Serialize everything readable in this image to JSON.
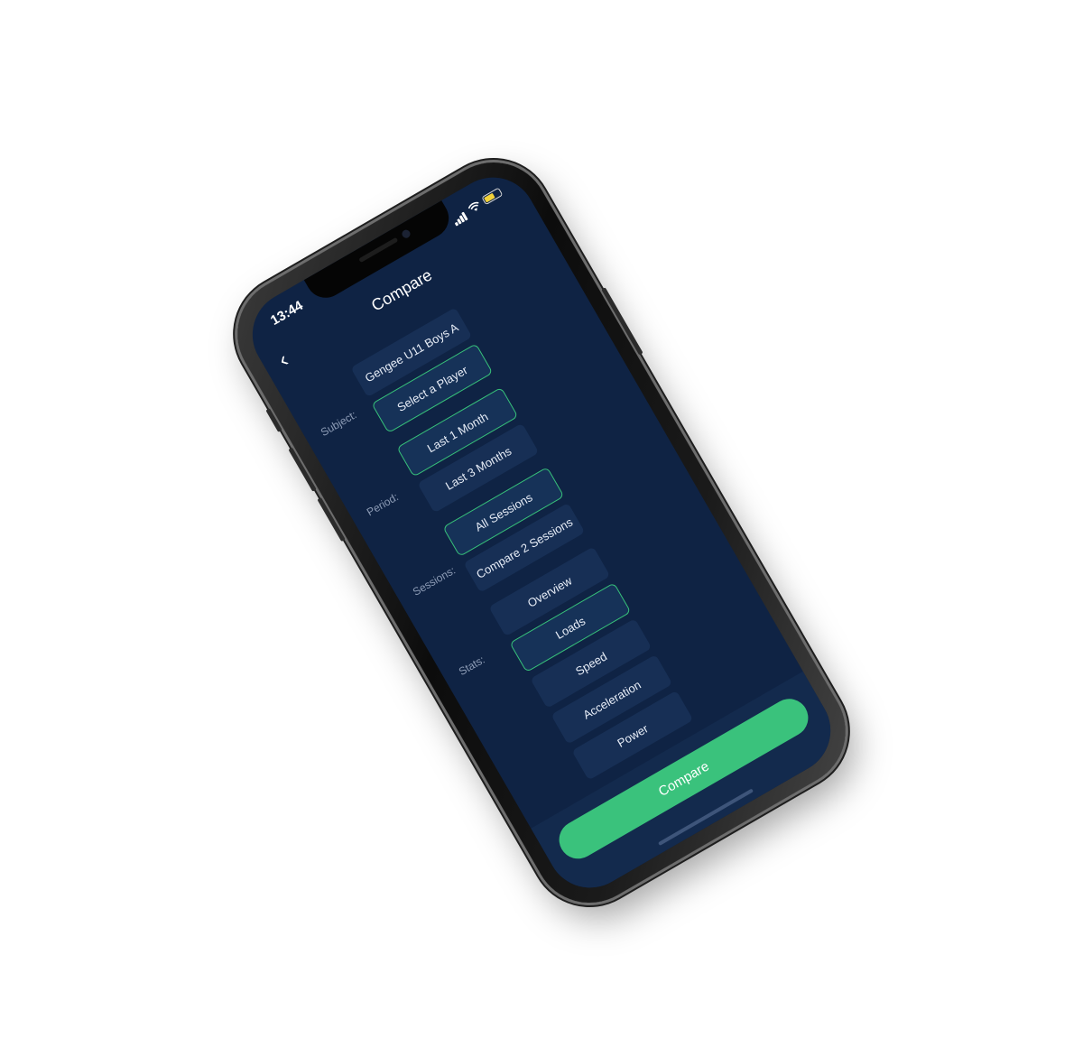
{
  "status_bar": {
    "time": "13:44",
    "battery_level": 0.6,
    "signal_icon": "signal-bars-icon",
    "wifi_icon": "wifi-icon",
    "battery_icon": "battery-icon"
  },
  "navbar": {
    "title": "Compare",
    "back_icon": "chevron-left-icon"
  },
  "subject": {
    "label": "Subject:",
    "options": [
      "Gengee U11 Boys A",
      "Select a Player"
    ],
    "selected": "Select a Player"
  },
  "period": {
    "label": "Period:",
    "options": [
      "Last 1 Month",
      "Last 3 Months"
    ],
    "selected": "Last 1 Month"
  },
  "sessions": {
    "label": "Sessions:",
    "options": [
      "All Sessions",
      "Compare 2 Sessions"
    ],
    "selected": "All Sessions"
  },
  "stats": {
    "label": "Stats:",
    "options": [
      "Overview",
      "Loads",
      "Speed",
      "Acceleration",
      "Power"
    ],
    "selected": "Loads"
  },
  "footer": {
    "compare_label": "Compare"
  },
  "colors": {
    "background": "#0f2344",
    "option_bg": "#172f55",
    "accent_green": "#3ac27c",
    "selected_border": "#37c17a",
    "label_text": "#8c9bb5"
  }
}
